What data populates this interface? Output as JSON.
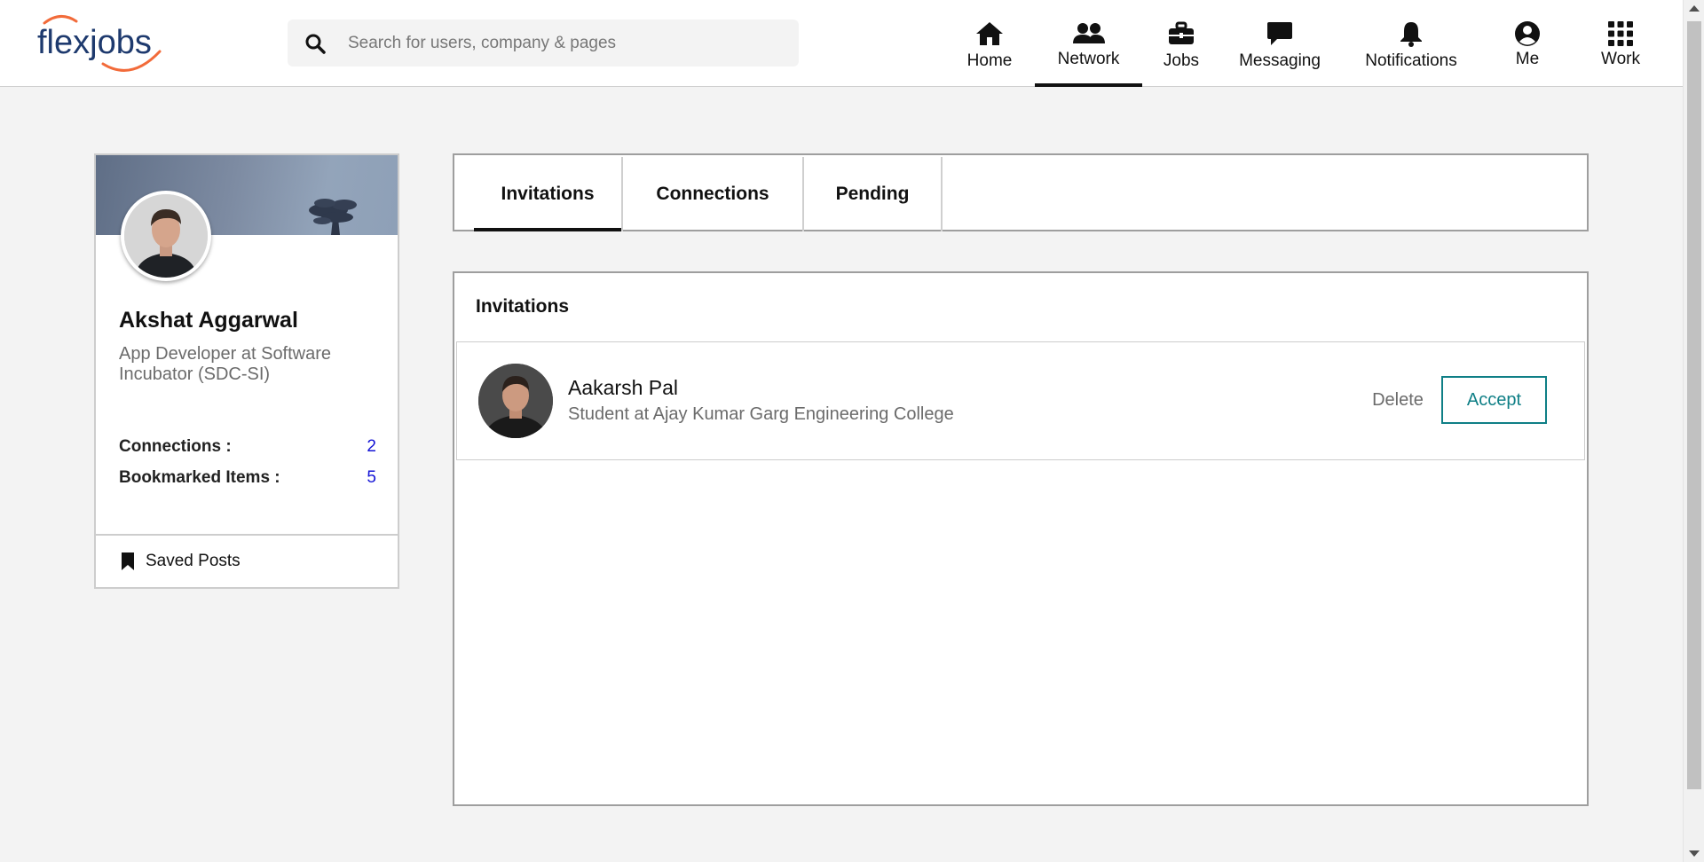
{
  "brand": {
    "logo_text": "flexjobs",
    "logo_color": "#1e3a6e",
    "logo_swoosh_color": "#f26b3a"
  },
  "search": {
    "placeholder": "Search for users, company & pages",
    "icon": "search-icon"
  },
  "nav": {
    "items": [
      {
        "label": "Home",
        "icon": "home-icon",
        "active": false
      },
      {
        "label": "Network",
        "icon": "users-icon",
        "active": true
      },
      {
        "label": "Jobs",
        "icon": "briefcase-icon",
        "active": false
      },
      {
        "label": "Messaging",
        "icon": "chat-icon",
        "active": false
      },
      {
        "label": "Notifications",
        "icon": "bell-icon",
        "active": false
      },
      {
        "label": "Me",
        "icon": "user-circle-icon",
        "active": false
      },
      {
        "label": "Work",
        "icon": "grid-icon",
        "active": false
      }
    ]
  },
  "profile": {
    "name": "Akshat Aggarwal",
    "headline": "App Developer at Software Incubator (SDC-SI)",
    "stats": [
      {
        "label": "Connections :",
        "value": "2"
      },
      {
        "label": "Bookmarked Items :",
        "value": "5"
      }
    ],
    "saved_posts_label": "Saved Posts"
  },
  "tabs": [
    {
      "label": "Invitations",
      "active": true
    },
    {
      "label": "Connections",
      "active": false
    },
    {
      "label": "Pending",
      "active": false
    }
  ],
  "invitations": {
    "title": "Invitations",
    "items": [
      {
        "name": "Aakarsh Pal",
        "headline": "Student at Ajay Kumar Garg Engineering College",
        "delete_label": "Delete",
        "accept_label": "Accept"
      }
    ]
  },
  "colors": {
    "accent": "#0f7f86",
    "link_blue": "#1414d6",
    "page_bg": "#f3f3f3"
  }
}
